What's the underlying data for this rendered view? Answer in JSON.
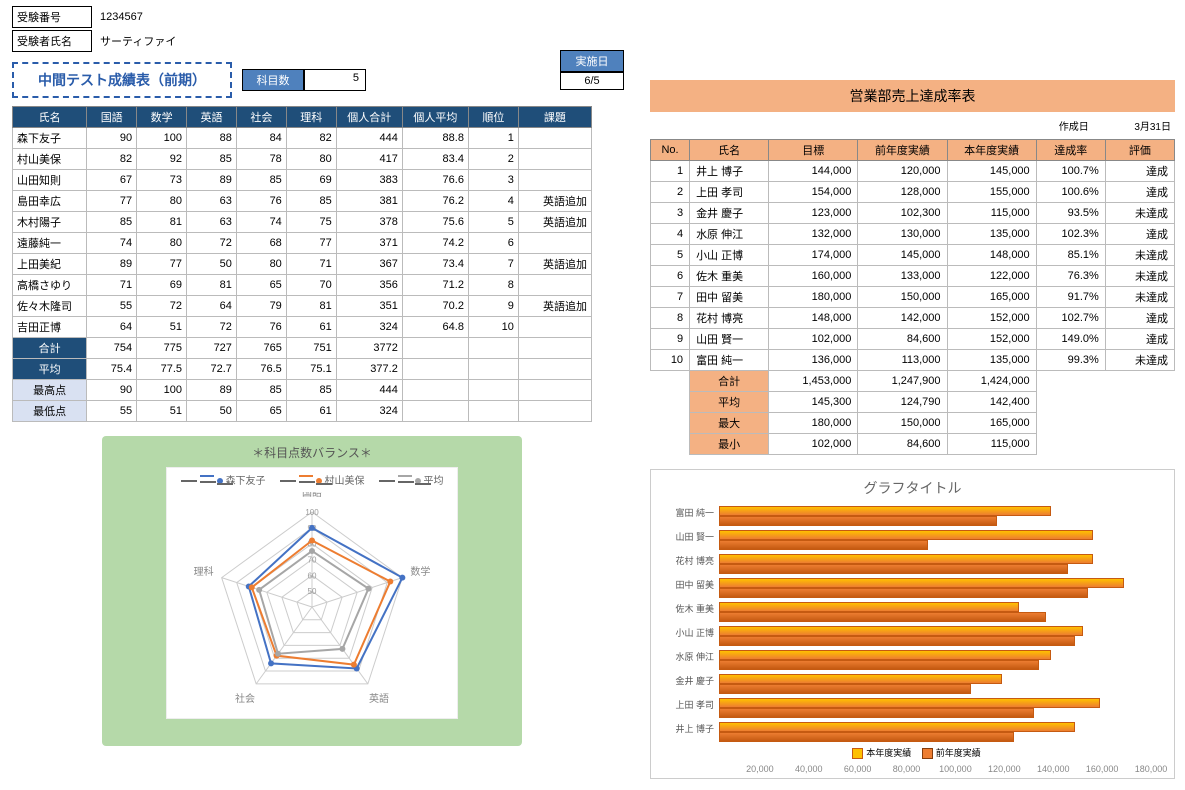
{
  "header": {
    "exam_no_label": "受験番号",
    "exam_no": "1234567",
    "name_label": "受験者氏名",
    "name": "サーティファイ"
  },
  "exec_date": {
    "label": "実施日",
    "value": "6/5"
  },
  "title": "中間テスト成績表（前期）",
  "subject_count": {
    "label": "科目数",
    "value": "5"
  },
  "score_headers": [
    "氏名",
    "国語",
    "数学",
    "英語",
    "社会",
    "理科",
    "個人合計",
    "個人平均",
    "順位",
    "課題"
  ],
  "students": [
    {
      "name": "森下友子",
      "v": [
        90,
        100,
        88,
        84,
        82,
        444,
        88.8,
        1,
        ""
      ]
    },
    {
      "name": "村山美保",
      "v": [
        82,
        92,
        85,
        78,
        80,
        417,
        83.4,
        2,
        ""
      ]
    },
    {
      "name": "山田知則",
      "v": [
        67,
        73,
        89,
        85,
        69,
        383,
        76.6,
        3,
        ""
      ]
    },
    {
      "name": "島田幸広",
      "v": [
        77,
        80,
        63,
        76,
        85,
        381,
        76.2,
        4,
        "英語追加"
      ]
    },
    {
      "name": "木村陽子",
      "v": [
        85,
        81,
        63,
        74,
        75,
        378,
        75.6,
        5,
        "英語追加"
      ]
    },
    {
      "name": "遠藤純一",
      "v": [
        74,
        80,
        72,
        68,
        77,
        371,
        74.2,
        6,
        ""
      ]
    },
    {
      "name": "上田美紀",
      "v": [
        89,
        77,
        50,
        80,
        71,
        367,
        73.4,
        7,
        "英語追加"
      ]
    },
    {
      "name": "高橋さゆり",
      "v": [
        71,
        69,
        81,
        65,
        70,
        356,
        71.2,
        8,
        ""
      ]
    },
    {
      "name": "佐々木隆司",
      "v": [
        55,
        72,
        64,
        79,
        81,
        351,
        70.2,
        9,
        "英語追加"
      ]
    },
    {
      "name": "吉田正博",
      "v": [
        64,
        51,
        72,
        76,
        61,
        324,
        64.8,
        10,
        ""
      ]
    }
  ],
  "summary": [
    {
      "label": "合計",
      "v": [
        754,
        775,
        727,
        765,
        751,
        3772,
        "",
        "",
        ""
      ]
    },
    {
      "label": "平均",
      "v": [
        75.4,
        77.5,
        72.7,
        76.5,
        75.1,
        377.2,
        "",
        "",
        ""
      ]
    },
    {
      "label": "最高点",
      "v": [
        90,
        100,
        89,
        85,
        85,
        444,
        "",
        "",
        ""
      ]
    },
    {
      "label": "最低点",
      "v": [
        55,
        51,
        50,
        65,
        61,
        324,
        "",
        "",
        ""
      ]
    }
  ],
  "chart_data": [
    {
      "type": "radar",
      "title": "＊科目点数バランス＊",
      "axes": [
        "国語",
        "数学",
        "英語",
        "社会",
        "理科"
      ],
      "ticks": [
        50,
        60,
        70,
        80,
        90,
        100
      ],
      "series": [
        {
          "name": "森下友子",
          "color": "#4472c4",
          "values": [
            90,
            100,
            88,
            84,
            82
          ]
        },
        {
          "name": "村山美保",
          "color": "#ed7d31",
          "values": [
            82,
            92,
            85,
            78,
            80
          ]
        },
        {
          "name": "平均",
          "color": "#a6a6a6",
          "values": [
            75.4,
            77.5,
            72.7,
            76.5,
            75.1
          ]
        }
      ]
    },
    {
      "type": "bar",
      "orientation": "horizontal",
      "title": "グラフタイトル",
      "categories": [
        "富田 純一",
        "山田 賢一",
        "花村 博亮",
        "田中 留美",
        "佐木 重美",
        "小山 正博",
        "水原 伸江",
        "金井 慶子",
        "上田 孝司",
        "井上 博子"
      ],
      "series": [
        {
          "name": "本年度実績",
          "color": "#ffc000",
          "values": [
            135000,
            152000,
            152000,
            165000,
            122000,
            148000,
            135000,
            115000,
            155000,
            145000
          ]
        },
        {
          "name": "前年度実績",
          "color": "#ed7d31",
          "values": [
            113000,
            84600,
            142000,
            150000,
            133000,
            145000,
            130000,
            102300,
            128000,
            120000
          ]
        }
      ],
      "xlim": [
        0,
        180000
      ],
      "xticks": [
        20000,
        40000,
        60000,
        80000,
        100000,
        120000,
        140000,
        160000,
        180000
      ],
      "legend": [
        "本年度実績",
        "前年度実績"
      ]
    }
  ],
  "sales": {
    "title": "営業部売上達成率表",
    "created_label": "作成日",
    "created": "3月31日",
    "headers": [
      "No.",
      "氏名",
      "目標",
      "前年度実績",
      "本年度実績",
      "達成率",
      "評価"
    ],
    "rows": [
      {
        "no": 1,
        "name": "井上 博子",
        "t": 144000,
        "p": 120000,
        "c": 145000,
        "r": "100.7%",
        "e": "達成"
      },
      {
        "no": 2,
        "name": "上田 孝司",
        "t": 154000,
        "p": 128000,
        "c": 155000,
        "r": "100.6%",
        "e": "達成"
      },
      {
        "no": 3,
        "name": "金井 慶子",
        "t": 123000,
        "p": 102300,
        "c": 115000,
        "r": "93.5%",
        "e": "未達成"
      },
      {
        "no": 4,
        "name": "水原 伸江",
        "t": 132000,
        "p": 130000,
        "c": 135000,
        "r": "102.3%",
        "e": "達成"
      },
      {
        "no": 5,
        "name": "小山 正博",
        "t": 174000,
        "p": 145000,
        "c": 148000,
        "r": "85.1%",
        "e": "未達成"
      },
      {
        "no": 6,
        "name": "佐木 重美",
        "t": 160000,
        "p": 133000,
        "c": 122000,
        "r": "76.3%",
        "e": "未達成"
      },
      {
        "no": 7,
        "name": "田中 留美",
        "t": 180000,
        "p": 150000,
        "c": 165000,
        "r": "91.7%",
        "e": "未達成"
      },
      {
        "no": 8,
        "name": "花村 博亮",
        "t": 148000,
        "p": 142000,
        "c": 152000,
        "r": "102.7%",
        "e": "達成"
      },
      {
        "no": 9,
        "name": "山田 賢一",
        "t": 102000,
        "p": 84600,
        "c": 152000,
        "r": "149.0%",
        "e": "達成"
      },
      {
        "no": 10,
        "name": "富田 純一",
        "t": 136000,
        "p": 113000,
        "c": 135000,
        "r": "99.3%",
        "e": "未達成"
      }
    ],
    "summary": [
      {
        "label": "合計",
        "v": [
          "1,453,000",
          "1,247,900",
          "1,424,000"
        ]
      },
      {
        "label": "平均",
        "v": [
          "145,300",
          "124,790",
          "142,400"
        ]
      },
      {
        "label": "最大",
        "v": [
          "180,000",
          "150,000",
          "165,000"
        ]
      },
      {
        "label": "最小",
        "v": [
          "102,000",
          "84,600",
          "115,000"
        ]
      }
    ]
  }
}
